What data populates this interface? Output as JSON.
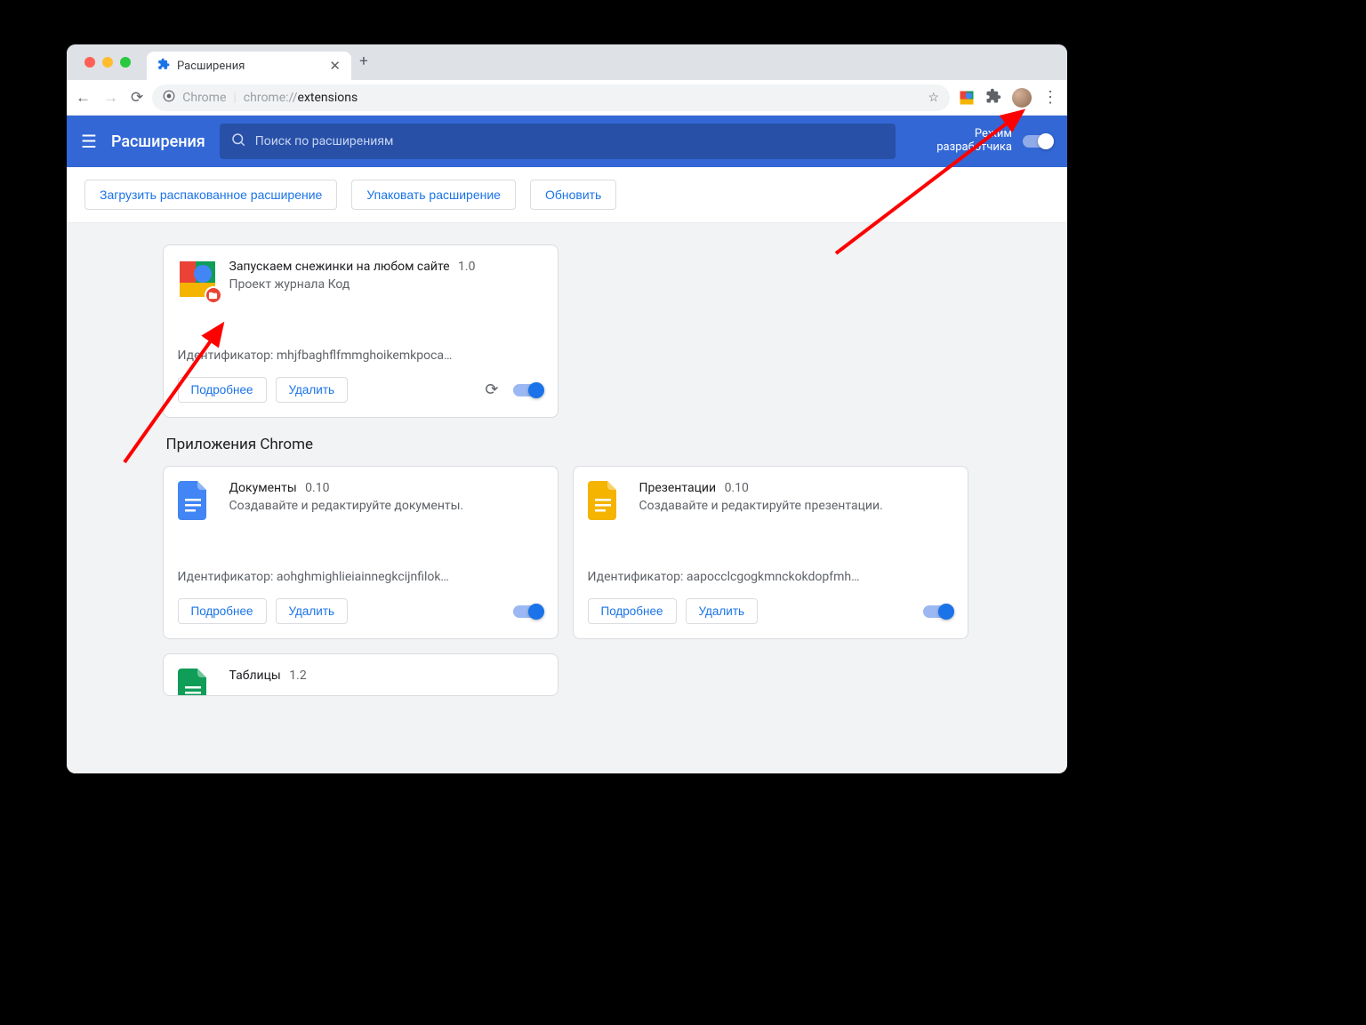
{
  "browser": {
    "tab_title": "Расширения",
    "url_prefix": "Chrome",
    "url_scheme": "chrome://",
    "url_path": "extensions"
  },
  "header": {
    "title": "Расширения",
    "search_placeholder": "Поиск по расширениям",
    "dev_mode_label_l1": "Режим",
    "dev_mode_label_l2": "разработчика"
  },
  "dev_buttons": {
    "load_unpacked": "Загрузить распакованное расширение",
    "pack": "Упаковать расширение",
    "update": "Обновить"
  },
  "extensions": [
    {
      "name": "Запускаем снежинки на любом сайте",
      "version": "1.0",
      "description": "Проект журнала Код",
      "id_label": "Идентификатор:",
      "id": "mhjfbaghflfmmghoikemkpoca…"
    }
  ],
  "apps_title": "Приложения Chrome",
  "apps": [
    {
      "name": "Документы",
      "version": "0.10",
      "description": "Создавайте и редактируйте документы.",
      "id_label": "Идентификатор:",
      "id": "aohghmighlieiainnegkcijnfilok…",
      "color": "#4285f4"
    },
    {
      "name": "Презентации",
      "version": "0.10",
      "description": "Создавайте и редактируйте презентации.",
      "id_label": "Идентификатор:",
      "id": "aapocclcgogkmnckokdopfmh…",
      "color": "#f4b400"
    },
    {
      "name": "Таблицы",
      "version": "1.2",
      "description": "",
      "id_label": "",
      "id": "",
      "color": "#0f9d58"
    }
  ],
  "card_buttons": {
    "details": "Подробнее",
    "remove": "Удалить"
  }
}
